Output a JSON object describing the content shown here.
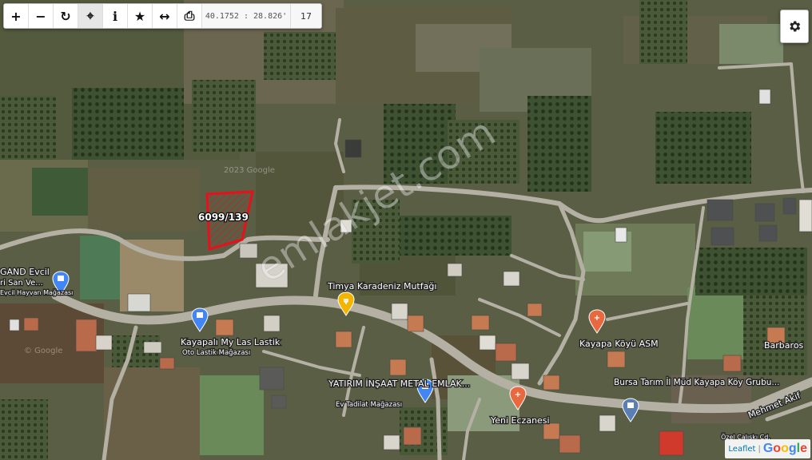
{
  "toolbar": {
    "zoom_in_label": "+",
    "zoom_out_label": "−",
    "refresh_label": "↻",
    "locate_label": "⌖",
    "info_label": "i",
    "favorite_label": "★",
    "measure_label": "↔",
    "print_label": "⎙",
    "coordinates": "40.1752 : 28.826'",
    "zoom_level": "17"
  },
  "map": {
    "parcel_label": "6099/139",
    "watermark": "emlakjet.com",
    "tile_watermarks": [
      "2023 Google",
      "© Google"
    ],
    "places": [
      {
        "name": "Timya Karadeniz Mutfağı",
        "subtitle": "",
        "icon": "restaurant-pin",
        "color": "#f5b400"
      },
      {
        "name": "Kayapalı My Las Lastik",
        "subtitle": "Oto Lastik Mağazası",
        "icon": "shop-pin",
        "color": "#4285f4"
      },
      {
        "name": "Kayapa Köyü ASM",
        "subtitle": "",
        "icon": "medical-pin",
        "color": "#e8683f"
      },
      {
        "name": "YATIRIM İNŞAAT METAL EMLAK...",
        "subtitle": "Ev Tadilat Mağazası",
        "icon": "shop-pin",
        "color": "#4285f4"
      },
      {
        "name": "Bursa Tarım İl Müd Kayapa Köy Grubu...",
        "subtitle": "",
        "icon": "gov-pin",
        "color": "#5b7fb5"
      },
      {
        "name": "Yeni Eczanesi",
        "subtitle": "",
        "icon": "pharmacy-pin",
        "color": "#e8683f"
      },
      {
        "name": "GAND Evcil",
        "subtitle": "",
        "icon": "shop-pin",
        "color": "#4285f4"
      },
      {
        "name": "ri San Ve...",
        "subtitle": "Evcil Hayvan Mağazası",
        "icon": "",
        "color": ""
      }
    ],
    "streets": [
      "Barbaros",
      "Mehmet Akif",
      "Özel Çalışkı Cd."
    ]
  },
  "attribution": {
    "leaflet": "Leaflet",
    "separator": "|",
    "google": "Google"
  },
  "colors": {
    "parcel_outline": "#e8101a",
    "road": "#b5b0a4",
    "toolbar_bg": "#ffffff"
  }
}
